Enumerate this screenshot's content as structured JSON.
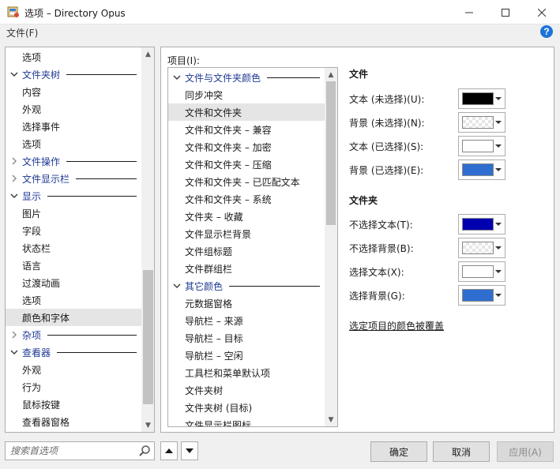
{
  "window": {
    "title": "选项 – Directory Opus"
  },
  "menu": {
    "file": "文件(F)"
  },
  "help": {
    "glyph": "?"
  },
  "nav": {
    "items": [
      {
        "label": "选项",
        "type": "item"
      },
      {
        "label": "文件夹树",
        "type": "group",
        "expanded": true
      },
      {
        "label": "内容",
        "type": "item"
      },
      {
        "label": "外观",
        "type": "item"
      },
      {
        "label": "选择事件",
        "type": "item"
      },
      {
        "label": "选项",
        "type": "item"
      },
      {
        "label": "文件操作",
        "type": "group",
        "expanded": false
      },
      {
        "label": "文件显示栏",
        "type": "group",
        "expanded": false
      },
      {
        "label": "显示",
        "type": "group",
        "expanded": true
      },
      {
        "label": "图片",
        "type": "item"
      },
      {
        "label": "字段",
        "type": "item"
      },
      {
        "label": "状态栏",
        "type": "item"
      },
      {
        "label": "语言",
        "type": "item"
      },
      {
        "label": "过渡动画",
        "type": "item"
      },
      {
        "label": "选项",
        "type": "item"
      },
      {
        "label": "颜色和字体",
        "type": "item",
        "selected": true
      },
      {
        "label": "杂项",
        "type": "group",
        "expanded": false
      },
      {
        "label": "查看器",
        "type": "group",
        "expanded": true
      },
      {
        "label": "外观",
        "type": "item"
      },
      {
        "label": "行为",
        "type": "item"
      },
      {
        "label": "鼠标按键",
        "type": "item"
      },
      {
        "label": "查看器窗格",
        "type": "item"
      }
    ]
  },
  "items_panel": {
    "label": "项目(I):",
    "items": [
      {
        "label": "文件与文件夹颜色",
        "type": "group",
        "expanded": true
      },
      {
        "label": "同步冲突",
        "type": "item"
      },
      {
        "label": "文件和文件夹",
        "type": "item",
        "selected": true
      },
      {
        "label": "文件和文件夹 – 兼容",
        "type": "item"
      },
      {
        "label": "文件和文件夹 – 加密",
        "type": "item"
      },
      {
        "label": "文件和文件夹 – 压缩",
        "type": "item"
      },
      {
        "label": "文件和文件夹 – 已匹配文本",
        "type": "item"
      },
      {
        "label": "文件和文件夹 – 系统",
        "type": "item"
      },
      {
        "label": "文件夹 – 收藏",
        "type": "item"
      },
      {
        "label": "文件显示栏背景",
        "type": "item"
      },
      {
        "label": "文件组标题",
        "type": "item"
      },
      {
        "label": "文件群组栏",
        "type": "item"
      },
      {
        "label": "其它颜色",
        "type": "group",
        "expanded": true
      },
      {
        "label": "元数据窗格",
        "type": "item"
      },
      {
        "label": "导航栏 – 来源",
        "type": "item"
      },
      {
        "label": "导航栏 – 目标",
        "type": "item"
      },
      {
        "label": "导航栏 – 空闲",
        "type": "item"
      },
      {
        "label": "工具栏和菜单默认项",
        "type": "item"
      },
      {
        "label": "文件夹树",
        "type": "item"
      },
      {
        "label": "文件夹树 (目标)",
        "type": "item"
      },
      {
        "label": "文件显示栏图标",
        "type": "item"
      }
    ]
  },
  "file_section": {
    "title": "文件",
    "rows": [
      {
        "label": "文本 (未选择)(U):",
        "color": "#000000",
        "checker": false
      },
      {
        "label": "背景 (未选择)(N):",
        "color": "",
        "checker": true
      },
      {
        "label": "文本 (已选择)(S):",
        "color": "#ffffff",
        "checker": false
      },
      {
        "label": "背景 (已选择)(E):",
        "color": "#2f6ed1",
        "checker": false
      }
    ]
  },
  "folder_section": {
    "title": "文件夹",
    "rows": [
      {
        "label": "不选择文本(T):",
        "color": "#0000b0",
        "checker": false
      },
      {
        "label": "不选择背景(B):",
        "color": "",
        "checker": true
      },
      {
        "label": "选择文本(X):",
        "color": "#ffffff",
        "checker": false
      },
      {
        "label": "选择背景(G):",
        "color": "#2f6ed1",
        "checker": false
      }
    ]
  },
  "note": "选定项目的颜色被覆盖",
  "search": {
    "placeholder": "搜索首选项"
  },
  "buttons": {
    "ok": "确定",
    "cancel": "取消",
    "apply": "应用(A)"
  },
  "colors": {
    "group_text": "#1f3a93",
    "selected_row": "#e5e5e5"
  }
}
